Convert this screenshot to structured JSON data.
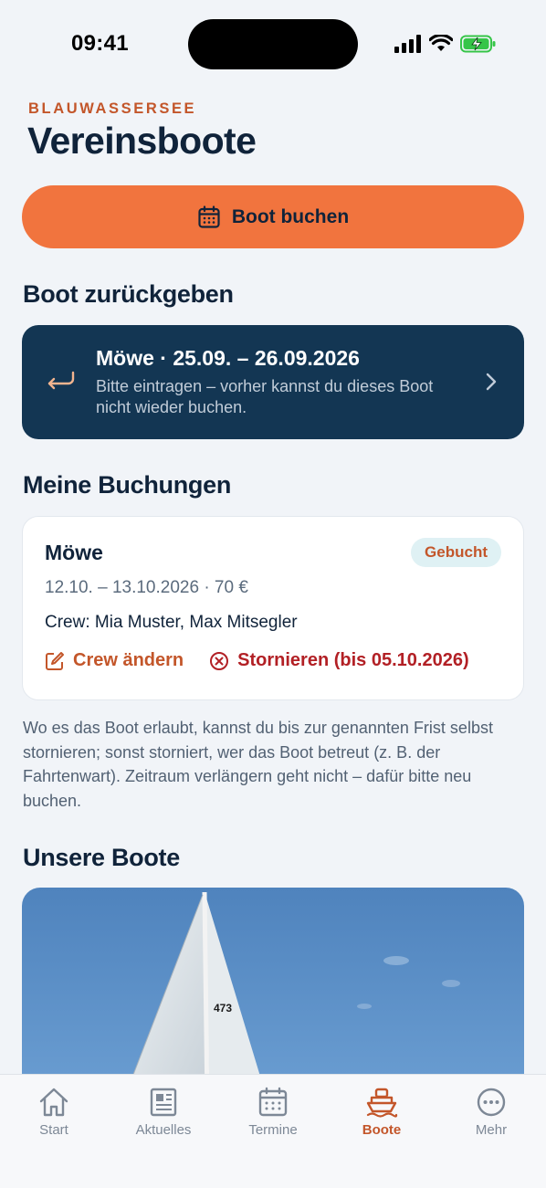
{
  "status_bar": {
    "time": "09:41"
  },
  "header": {
    "kicker": "BLAUWASSERSEE",
    "title": "Vereinsboote"
  },
  "book_button": {
    "label": "Boot buchen",
    "icon": "calendar-icon"
  },
  "return_section": {
    "heading": "Boot zurückgeben",
    "card": {
      "title": "Möwe · 25.09. – 26.09.2026",
      "subtitle": "Bitte eintragen – vorher kannst du dieses Boot nicht wieder buchen.",
      "icon": "return-arrow-icon"
    }
  },
  "bookings_section": {
    "heading": "Meine Buchungen",
    "booking": {
      "boat": "Möwe",
      "status": "Gebucht",
      "dates_price": "12.10. – 13.10.2026 · 70 €",
      "crew": "Crew: Mia Muster, Max Mitsegler",
      "edit_label": "Crew ändern",
      "cancel_label": "Stornieren (bis 05.10.2026)"
    },
    "note": "Wo es das Boot erlaubt, kannst du bis zur genannten Frist selbst stornieren; sonst storniert, wer das Boot betreut (z. B. der Fahrtenwart). Zeitraum verlängern geht nicht – dafür bitte neu buchen."
  },
  "boats_section": {
    "heading": "Unsere Boote",
    "sail_number": "473"
  },
  "tabbar": {
    "tabs": [
      {
        "label": "Start",
        "icon": "house-icon"
      },
      {
        "label": "Aktuelles",
        "icon": "newspaper-icon"
      },
      {
        "label": "Termine",
        "icon": "calendar-icon"
      },
      {
        "label": "Boote",
        "icon": "boat-icon",
        "active": true
      },
      {
        "label": "Mehr",
        "icon": "more-icon"
      }
    ]
  },
  "colors": {
    "accent": "#f1743e",
    "accent_text": "#c3562a",
    "navy": "#133653",
    "danger": "#b22025",
    "background": "#f1f4f8"
  }
}
